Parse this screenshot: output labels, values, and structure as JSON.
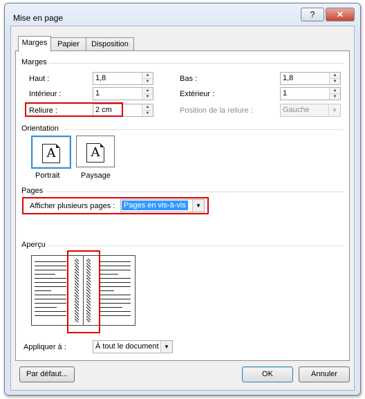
{
  "window": {
    "title": "Mise en page",
    "help": "?",
    "close": "✕"
  },
  "tabs": [
    "Marges",
    "Papier",
    "Disposition"
  ],
  "margins": {
    "section": "Marges",
    "top_label": "Haut :",
    "top_value": "1,8",
    "bottom_label": "Bas :",
    "bottom_value": "1,8",
    "inside_label": "Intérieur :",
    "inside_value": "1",
    "outside_label": "Extérieur :",
    "outside_value": "1",
    "gutter_label": "Reliure :",
    "gutter_value": "2 cm",
    "gutter_pos_label": "Position de la reliure :",
    "gutter_pos_value": "Gauche"
  },
  "orientation": {
    "section": "Orientation",
    "portrait": "Portrait",
    "landscape": "Paysage",
    "glyph": "A"
  },
  "pages": {
    "section": "Pages",
    "multi_label": "Afficher plusieurs pages :",
    "multi_value": "Pages en vis-à-vis"
  },
  "preview": {
    "section": "Aperçu"
  },
  "apply": {
    "label": "Appliquer à :",
    "value": "À tout le document"
  },
  "buttons": {
    "default": "Par défaut...",
    "ok": "OK",
    "cancel": "Annuler"
  },
  "colors": {
    "highlight": "#e00000",
    "selection": "#3399ff"
  }
}
